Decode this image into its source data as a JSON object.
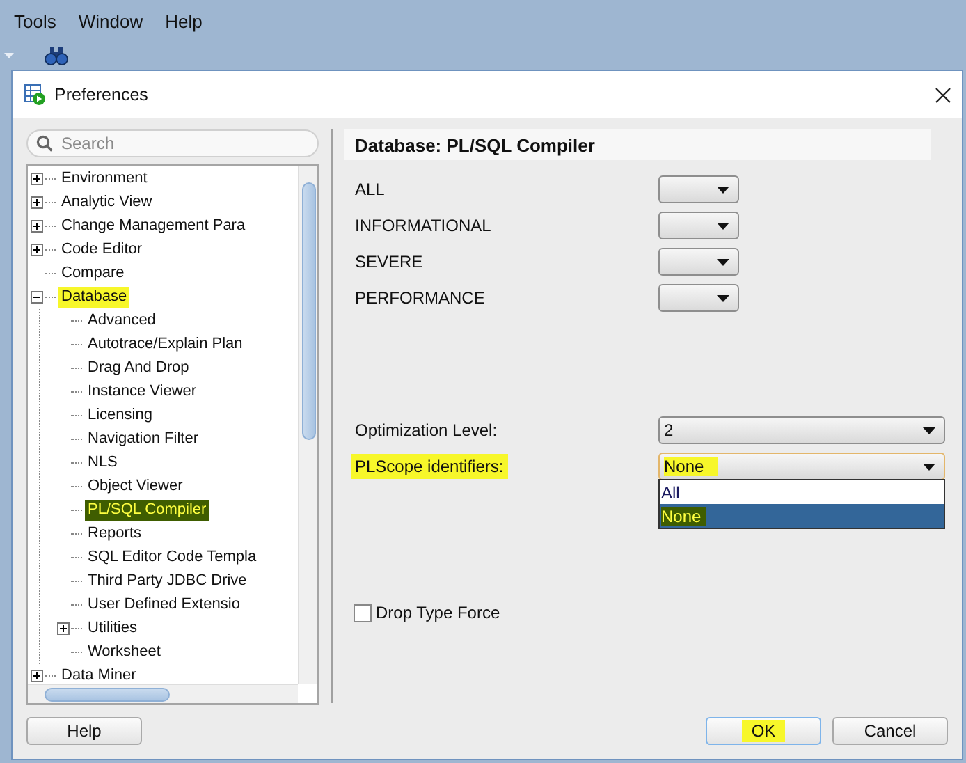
{
  "menu_bar": {
    "items": [
      "Tools",
      "Window",
      "Help"
    ]
  },
  "dialog": {
    "title": "Preferences",
    "search": {
      "placeholder": "Search"
    },
    "tree": [
      {
        "label": "Environment",
        "expanded": false,
        "selected": false,
        "highlighted": false
      },
      {
        "label": "Analytic View",
        "expanded": false,
        "selected": false,
        "highlighted": false
      },
      {
        "label": "Change Management Para",
        "expanded": false,
        "selected": false,
        "highlighted": false
      },
      {
        "label": "Code Editor",
        "expanded": false,
        "selected": false,
        "highlighted": false
      },
      {
        "label": "Compare",
        "selected": false,
        "highlighted": false
      },
      {
        "label": "Database",
        "expanded": true,
        "selected": false,
        "highlighted": true,
        "children": [
          {
            "label": "Advanced",
            "selected": false,
            "highlighted": false
          },
          {
            "label": "Autotrace/Explain Plan",
            "selected": false,
            "highlighted": false
          },
          {
            "label": "Drag And Drop",
            "selected": false,
            "highlighted": false
          },
          {
            "label": "Instance Viewer",
            "selected": false,
            "highlighted": false
          },
          {
            "label": "Licensing",
            "selected": false,
            "highlighted": false
          },
          {
            "label": "Navigation Filter",
            "selected": false,
            "highlighted": false
          },
          {
            "label": "NLS",
            "selected": false,
            "highlighted": false
          },
          {
            "label": "Object Viewer",
            "selected": false,
            "highlighted": false
          },
          {
            "label": "PL/SQL Compiler",
            "selected": true,
            "highlighted": true
          },
          {
            "label": "Reports",
            "selected": false,
            "highlighted": false
          },
          {
            "label": "SQL Editor Code Templa",
            "selected": false,
            "highlighted": false
          },
          {
            "label": "Third Party JDBC Drive",
            "selected": false,
            "highlighted": false
          },
          {
            "label": "User Defined Extensio",
            "selected": false,
            "highlighted": false
          },
          {
            "label": "Utilities",
            "expanded": false,
            "selected": false,
            "highlighted": false
          },
          {
            "label": "Worksheet",
            "selected": false,
            "highlighted": false
          }
        ]
      },
      {
        "label": "Data Miner",
        "expanded": false,
        "selected": false,
        "highlighted": false
      }
    ],
    "panel": {
      "title": "Database: PL/SQL Compiler",
      "warning_settings": [
        {
          "label": "ALL"
        },
        {
          "label": "INFORMATIONAL"
        },
        {
          "label": "SEVERE"
        },
        {
          "label": "PERFORMANCE"
        }
      ],
      "optimization_level": {
        "label": "Optimization Level:",
        "value": "2"
      },
      "plscope_identifiers": {
        "label": "PLScope identifiers:",
        "value": "None",
        "highlighted": true,
        "expanded": true,
        "options": [
          {
            "label": "All",
            "selected": false,
            "highlighted": false
          },
          {
            "label": "None",
            "selected": true,
            "highlighted": true
          }
        ]
      },
      "drop_type_force": {
        "label": "Drop Type Force",
        "checked": false
      }
    },
    "buttons": [
      {
        "label": "Help",
        "default": false,
        "highlighted": false
      },
      {
        "label": "OK",
        "default": true,
        "highlighted": true
      },
      {
        "label": "Cancel",
        "default": false,
        "highlighted": false
      }
    ]
  }
}
